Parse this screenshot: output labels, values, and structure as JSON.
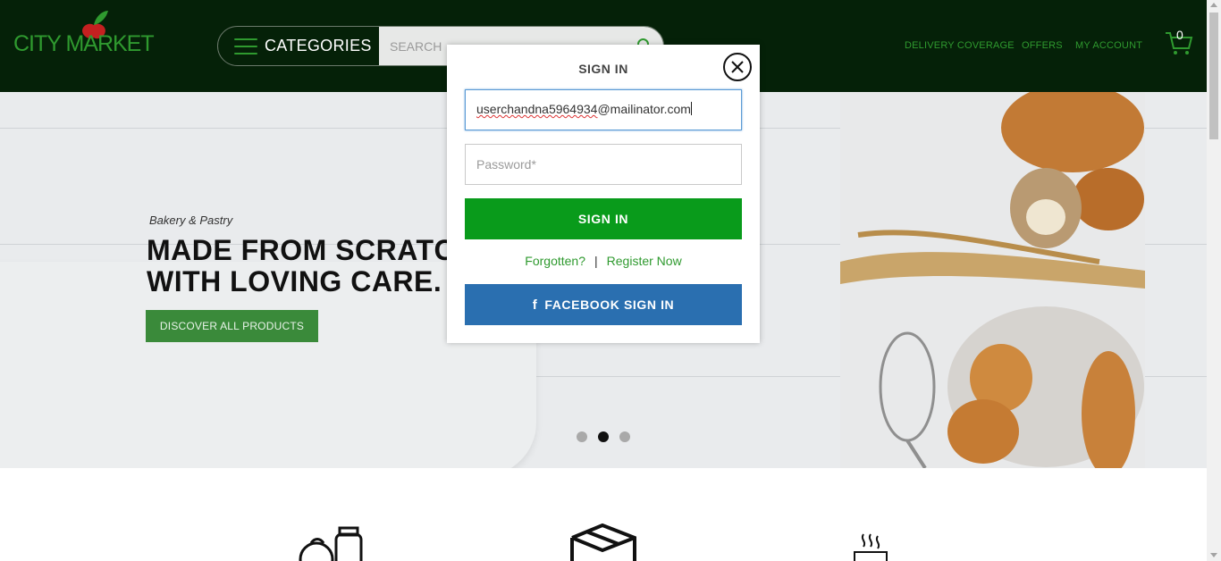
{
  "header": {
    "logo_text": "CITY MARKET",
    "categories_label": "CATEGORIES",
    "search_placeholder": "SEARCH",
    "nav": {
      "delivery": "DELIVERY COVERAGE",
      "offers": "OFFERS",
      "account": "MY ACCOUNT"
    },
    "cart_count": "0"
  },
  "hero": {
    "subtitle": "Bakery & Pastry",
    "headline_line1": "MADE FROM SCRATCH",
    "headline_line2": "WITH LOVING CARE.",
    "cta": "DISCOVER ALL PRODUCTS",
    "slides": 3,
    "active_slide": 2
  },
  "modal": {
    "title": "SIGN IN",
    "email_value_underlined": "userchandna5964934",
    "email_value_rest": "@mailinator.com",
    "password_placeholder": "Password*",
    "signin_label": "SIGN IN",
    "forgot_label": "Forgotten?",
    "separator": "|",
    "register_label": "Register Now",
    "facebook_label": "FACEBOOK SIGN IN"
  },
  "colors": {
    "header_bg": "#052108",
    "brand_green": "#2f9a2f",
    "signin_green": "#099b1b",
    "facebook_blue": "#2a6fb0"
  }
}
